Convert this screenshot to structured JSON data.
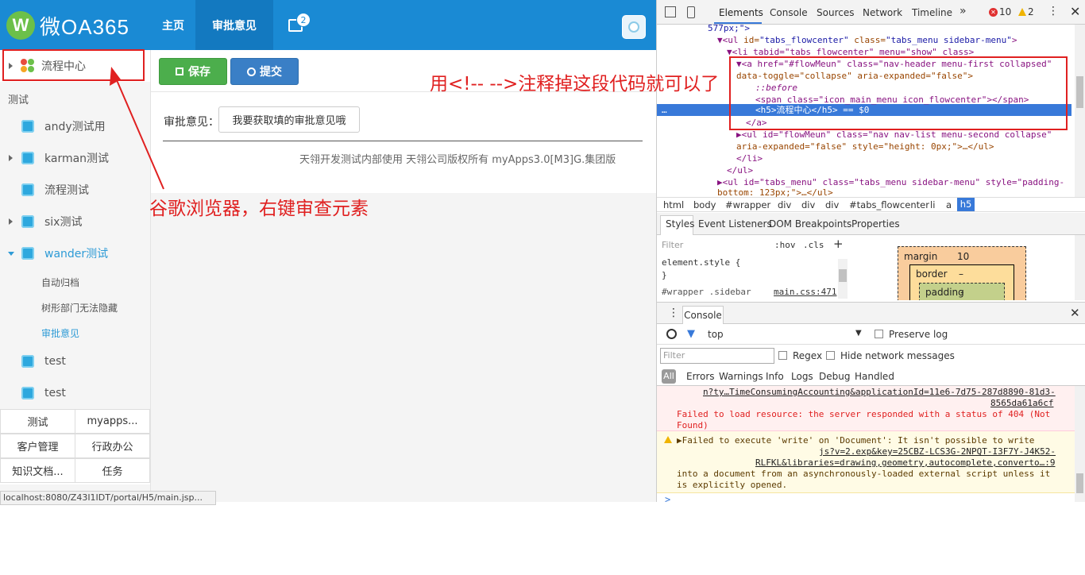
{
  "app": {
    "logo_mark": "W",
    "logo_text": "微OA365",
    "nav": {
      "home": "主页",
      "approve": "审批意见",
      "msg_count": "2"
    },
    "toolbar": {
      "save_label": "保存",
      "submit_label": "提交"
    },
    "form": {
      "opinion_label": "审批意见：",
      "opinion_button": "我要获取填的审批意见哦"
    },
    "footer": "天翎开发测试内部使用 天翎公司版权所有 myApps3.0[M3]G.集团版",
    "status_url": "localhost:8080/Z43I1IDT/portal/H5/main.jsp...",
    "sidebar": {
      "flow_center": "流程中心",
      "section": "测试",
      "items": [
        {
          "label": "andy测试用"
        },
        {
          "label": "karman测试"
        },
        {
          "label": "流程测试"
        },
        {
          "label": "six测试"
        },
        {
          "label": "wander测试"
        }
      ],
      "sub_items": [
        "自动归档",
        "树形部门无法隐藏",
        "审批意见"
      ],
      "tests": [
        "test",
        "test"
      ],
      "grid": [
        "测试",
        "myapps...",
        "客户管理",
        "行政办公",
        "知识文档...",
        "任务"
      ]
    }
  },
  "annotations": {
    "right": "用<!-- -->注释掉这段代码就可以了",
    "left": "谷歌浏览器，右键审查元素"
  },
  "devtools": {
    "tabs": [
      "Elements",
      "Console",
      "Sources",
      "Network",
      "Timeline",
      "»"
    ],
    "errors": "10",
    "warnings": "2",
    "dom": {
      "l0": "577px;\">",
      "l1_tag": "<ul",
      "l1_a1": "id=",
      "l1_v1": "\"tabs_flowcenter\"",
      "l1_a2": "class=",
      "l1_v2": "\"tabs_menu sidebar-menu\"",
      "l1_end": ">",
      "l2": "<li tabid=\"tabs_flowcenter\" menu=\"show\" class>",
      "l3": "<a href=\"#flowMeun\" class=\"nav-header menu-first collapsed\"",
      "l4": "data-toggle=\"collapse\" aria-expanded=\"false\">",
      "l5": "::before",
      "l6": "<span class=\"icon_main_menu icon_flowcenter\"></span>",
      "l7": "<h5>流程中心</h5> == $0",
      "l8": "</a>",
      "l9": "<ul id=\"flowMeun\" class=\"nav nav-list menu-second collapse\"",
      "l10": "aria-expanded=\"false\" style=\"height: 0px;\">…</ul>",
      "l11": "</li>",
      "l12": "</ul>",
      "l13": "<ul id=\"tabs_menu\" class=\"tabs_menu sidebar-menu\" style=\"padding-",
      "l14": "bottom: 123px;\">…</ul>",
      "ellipsis": "…"
    },
    "crumbs": [
      "html",
      "body",
      "#wrapper",
      "div",
      "div",
      "div",
      "#tabs_flowcenter",
      "li",
      "a",
      "h5"
    ],
    "style_tabs": [
      "Styles",
      "Event Listeners",
      "DOM Breakpoints",
      "Properties"
    ],
    "styles": {
      "filter": "Filter",
      "hov": ":hov",
      "cls": ".cls",
      "plus": "+",
      "el_style": "element.style {",
      "close": "}",
      "rule": "#wrapper .sidebar",
      "source": "main.css:471"
    },
    "box": {
      "margin": "margin",
      "margin_val": "10",
      "border": "border",
      "border_val": "–",
      "padding": "padding",
      "padding_val": "-"
    },
    "console_tab": "Console",
    "console_top": "top",
    "preserve": "Preserve log",
    "filter_placeholder": "Filter",
    "regex": "Regex",
    "hide_network": "Hide network messages",
    "levels": [
      "All",
      "Errors",
      "Warnings",
      "Info",
      "Logs",
      "Debug",
      "Handled"
    ],
    "log": {
      "e1": "n?ty…TimeConsumingAccounting&applicationId=11e6-7d75-287d8890-81d3-",
      "e2": "8565da61a6cf",
      "e3": "Failed to load resource: the server responded with a status of 404 (Not",
      "e4": "Found)",
      "w1": "▶Failed to execute 'write' on 'Document': It isn't possible to write",
      "w2": "js?v=2.exp&key=25CBZ-LCS3G-2NPQT-I3F7Y-J4K52-",
      "w3": "RLFKL&libraries=drawing,geometry,autocomplete,converto…:9",
      "w4": "into a document from an asynchronously-loaded external script unless it",
      "w5": "is explicitly opened.",
      "prompt": ">"
    }
  }
}
